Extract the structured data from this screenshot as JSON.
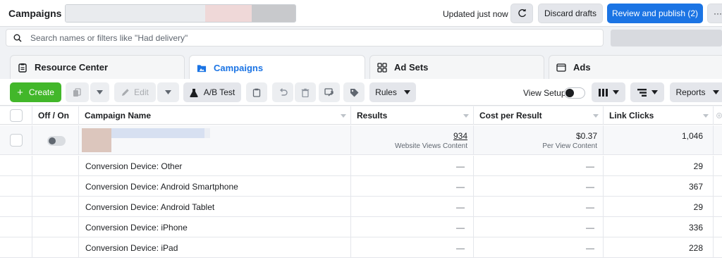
{
  "header": {
    "title": "Campaigns",
    "updated": "Updated just now",
    "discard": "Discard drafts",
    "review": "Review and publish (2)",
    "more": "···"
  },
  "search": {
    "placeholder": "Search names or filters like \"Had delivery\""
  },
  "tabs": [
    {
      "label": "Resource Center",
      "icon": "clipboard-icon"
    },
    {
      "label": "Campaigns",
      "icon": "folder-icon",
      "active": true
    },
    {
      "label": "Ad Sets",
      "icon": "grid-icon"
    },
    {
      "label": "Ads",
      "icon": "window-icon"
    }
  ],
  "toolbar": {
    "create": "Create",
    "edit": "Edit",
    "abtest": "A/B Test",
    "rules": "Rules",
    "view_setup": "View Setup",
    "reports": "Reports"
  },
  "table": {
    "columns": [
      "Off / On",
      "Campaign Name",
      "Results",
      "Cost per Result",
      "Link Clicks"
    ],
    "campaign": {
      "results": "934",
      "results_sub": "Website Views Content",
      "cost": "$0.37",
      "cost_sub": "Per View Content",
      "link_clicks": "1,046"
    },
    "breakdown_rows": [
      {
        "name": "Conversion Device: Other",
        "results": "—",
        "cost": "—",
        "link_clicks": "29"
      },
      {
        "name": "Conversion Device: Android Smartphone",
        "results": "—",
        "cost": "—",
        "link_clicks": "367"
      },
      {
        "name": "Conversion Device: Android Tablet",
        "results": "—",
        "cost": "—",
        "link_clicks": "29"
      },
      {
        "name": "Conversion Device: iPhone",
        "results": "—",
        "cost": "—",
        "link_clicks": "336"
      },
      {
        "name": "Conversion Device: iPad",
        "results": "—",
        "cost": "—",
        "link_clicks": "228"
      }
    ]
  },
  "colors": {
    "accent": "#1b74e4",
    "create": "#42b72a"
  }
}
